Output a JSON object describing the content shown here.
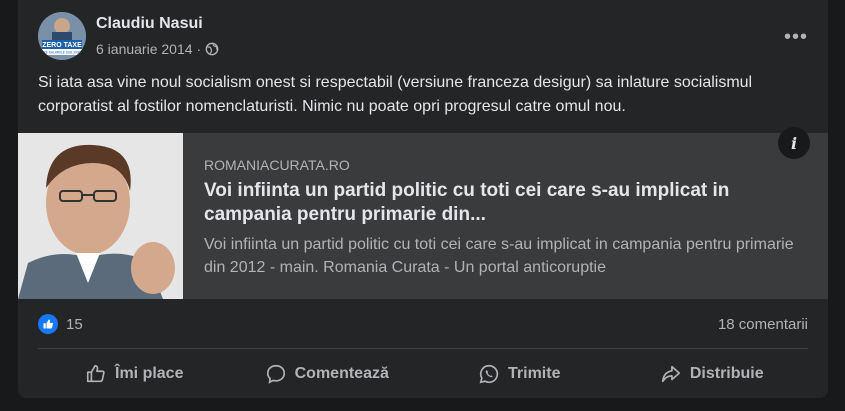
{
  "post": {
    "author": "Claudiu Nasui",
    "date": "6 ianuarie 2014",
    "separator": "·",
    "privacy_icon": "globe-icon",
    "text": "Si iata asa vine noul socialism onest si respectabil (versiune franceza desigur) sa inlature socialismul corporatist al fostilor nomenclaturisti. Nimic nu poate opri progresul catre omul nou."
  },
  "avatar": {
    "banner_line1": "ZERO TAXE",
    "banner_line2": "PE SALARIILE SUB 3000"
  },
  "link": {
    "domain": "ROMANIACURATA.RO",
    "title": "Voi infiinta un partid politic cu toti cei care s-au implicat in campania pentru primarie din...",
    "description": "Voi infiinta un partid politic cu toti cei care s-au implicat in campania pentru primarie din 2012 - main. Romania Curata - Un portal anticoruptie",
    "info_label": "i"
  },
  "reactions": {
    "like_count": "15",
    "comments": "18 comentarii"
  },
  "actions": {
    "like": "Îmi place",
    "comment": "Comentează",
    "send": "Trimite",
    "share": "Distribuie"
  },
  "colors": {
    "background": "#18191a",
    "card": "#242526",
    "link_preview": "#3a3b3c",
    "primary_text": "#e4e6eb",
    "secondary_text": "#b0b3b8",
    "like_blue": "#1877f2"
  }
}
